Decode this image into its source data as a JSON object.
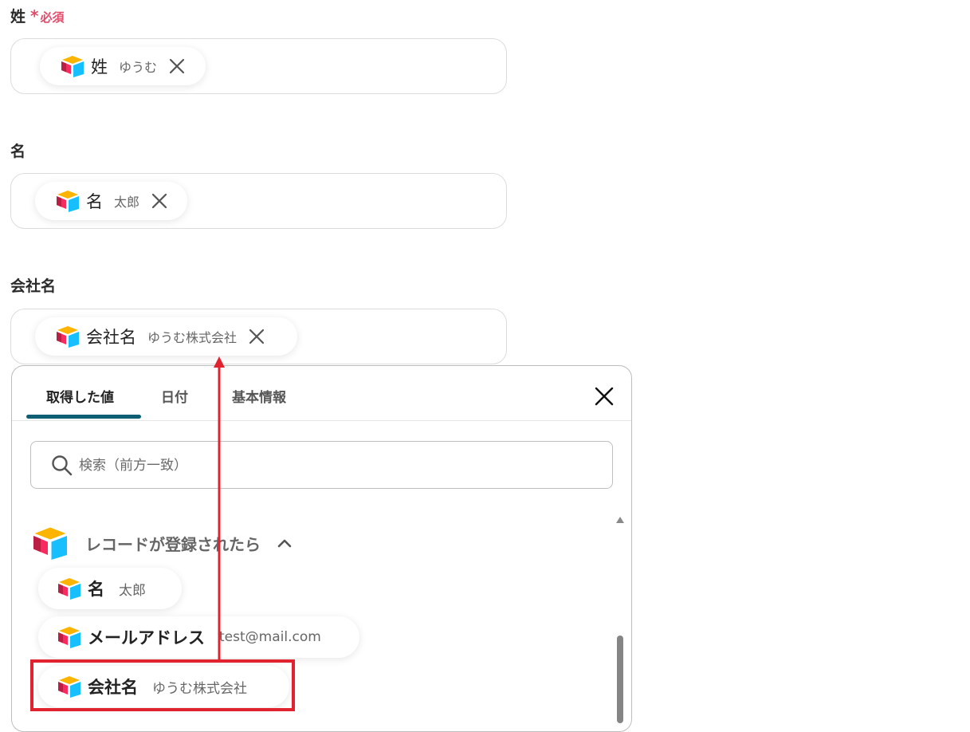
{
  "fields": [
    {
      "label": "姓",
      "required_star": "*",
      "required_text": "必須",
      "chip": {
        "title": "姓",
        "value": "ゆうむ"
      }
    },
    {
      "label": "名",
      "chip": {
        "title": "名",
        "value": "太郎"
      }
    },
    {
      "label": "会社名",
      "chip": {
        "title": "会社名",
        "value": "ゆうむ株式会社"
      }
    }
  ],
  "panel": {
    "tabs": [
      {
        "label": "取得した値"
      },
      {
        "label": "日付"
      },
      {
        "label": "基本情報"
      }
    ],
    "search": {
      "placeholder": "検索（前方一致）"
    },
    "group": {
      "title": "レコードが登録されたら"
    },
    "items": [
      {
        "title": "名",
        "value": "太郎"
      },
      {
        "title": "メールアドレス",
        "value": "test@mail.com"
      },
      {
        "title": "会社名",
        "value": "ゆうむ株式会社"
      }
    ]
  },
  "colors": {
    "accent": "#0f5f74",
    "required": "#e24a6a",
    "highlight": "#e0232f"
  },
  "icons": [
    "airtable-logo-icon",
    "close-icon",
    "search-icon",
    "chevron-up-icon"
  ]
}
